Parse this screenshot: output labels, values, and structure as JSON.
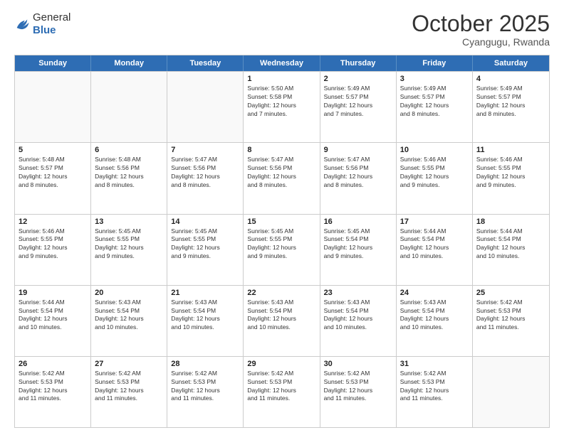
{
  "header": {
    "logo_general": "General",
    "logo_blue": "Blue",
    "month_title": "October 2025",
    "location": "Cyangugu, Rwanda"
  },
  "days_of_week": [
    "Sunday",
    "Monday",
    "Tuesday",
    "Wednesday",
    "Thursday",
    "Friday",
    "Saturday"
  ],
  "weeks": [
    [
      {
        "day": "",
        "info": "",
        "empty": true
      },
      {
        "day": "",
        "info": "",
        "empty": true
      },
      {
        "day": "",
        "info": "",
        "empty": true
      },
      {
        "day": "1",
        "info": "Sunrise: 5:50 AM\nSunset: 5:58 PM\nDaylight: 12 hours\nand 7 minutes.",
        "empty": false
      },
      {
        "day": "2",
        "info": "Sunrise: 5:49 AM\nSunset: 5:57 PM\nDaylight: 12 hours\nand 7 minutes.",
        "empty": false
      },
      {
        "day": "3",
        "info": "Sunrise: 5:49 AM\nSunset: 5:57 PM\nDaylight: 12 hours\nand 8 minutes.",
        "empty": false
      },
      {
        "day": "4",
        "info": "Sunrise: 5:49 AM\nSunset: 5:57 PM\nDaylight: 12 hours\nand 8 minutes.",
        "empty": false
      }
    ],
    [
      {
        "day": "5",
        "info": "Sunrise: 5:48 AM\nSunset: 5:57 PM\nDaylight: 12 hours\nand 8 minutes.",
        "empty": false
      },
      {
        "day": "6",
        "info": "Sunrise: 5:48 AM\nSunset: 5:56 PM\nDaylight: 12 hours\nand 8 minutes.",
        "empty": false
      },
      {
        "day": "7",
        "info": "Sunrise: 5:47 AM\nSunset: 5:56 PM\nDaylight: 12 hours\nand 8 minutes.",
        "empty": false
      },
      {
        "day": "8",
        "info": "Sunrise: 5:47 AM\nSunset: 5:56 PM\nDaylight: 12 hours\nand 8 minutes.",
        "empty": false
      },
      {
        "day": "9",
        "info": "Sunrise: 5:47 AM\nSunset: 5:56 PM\nDaylight: 12 hours\nand 8 minutes.",
        "empty": false
      },
      {
        "day": "10",
        "info": "Sunrise: 5:46 AM\nSunset: 5:55 PM\nDaylight: 12 hours\nand 9 minutes.",
        "empty": false
      },
      {
        "day": "11",
        "info": "Sunrise: 5:46 AM\nSunset: 5:55 PM\nDaylight: 12 hours\nand 9 minutes.",
        "empty": false
      }
    ],
    [
      {
        "day": "12",
        "info": "Sunrise: 5:46 AM\nSunset: 5:55 PM\nDaylight: 12 hours\nand 9 minutes.",
        "empty": false
      },
      {
        "day": "13",
        "info": "Sunrise: 5:45 AM\nSunset: 5:55 PM\nDaylight: 12 hours\nand 9 minutes.",
        "empty": false
      },
      {
        "day": "14",
        "info": "Sunrise: 5:45 AM\nSunset: 5:55 PM\nDaylight: 12 hours\nand 9 minutes.",
        "empty": false
      },
      {
        "day": "15",
        "info": "Sunrise: 5:45 AM\nSunset: 5:55 PM\nDaylight: 12 hours\nand 9 minutes.",
        "empty": false
      },
      {
        "day": "16",
        "info": "Sunrise: 5:45 AM\nSunset: 5:54 PM\nDaylight: 12 hours\nand 9 minutes.",
        "empty": false
      },
      {
        "day": "17",
        "info": "Sunrise: 5:44 AM\nSunset: 5:54 PM\nDaylight: 12 hours\nand 10 minutes.",
        "empty": false
      },
      {
        "day": "18",
        "info": "Sunrise: 5:44 AM\nSunset: 5:54 PM\nDaylight: 12 hours\nand 10 minutes.",
        "empty": false
      }
    ],
    [
      {
        "day": "19",
        "info": "Sunrise: 5:44 AM\nSunset: 5:54 PM\nDaylight: 12 hours\nand 10 minutes.",
        "empty": false
      },
      {
        "day": "20",
        "info": "Sunrise: 5:43 AM\nSunset: 5:54 PM\nDaylight: 12 hours\nand 10 minutes.",
        "empty": false
      },
      {
        "day": "21",
        "info": "Sunrise: 5:43 AM\nSunset: 5:54 PM\nDaylight: 12 hours\nand 10 minutes.",
        "empty": false
      },
      {
        "day": "22",
        "info": "Sunrise: 5:43 AM\nSunset: 5:54 PM\nDaylight: 12 hours\nand 10 minutes.",
        "empty": false
      },
      {
        "day": "23",
        "info": "Sunrise: 5:43 AM\nSunset: 5:54 PM\nDaylight: 12 hours\nand 10 minutes.",
        "empty": false
      },
      {
        "day": "24",
        "info": "Sunrise: 5:43 AM\nSunset: 5:54 PM\nDaylight: 12 hours\nand 10 minutes.",
        "empty": false
      },
      {
        "day": "25",
        "info": "Sunrise: 5:42 AM\nSunset: 5:53 PM\nDaylight: 12 hours\nand 11 minutes.",
        "empty": false
      }
    ],
    [
      {
        "day": "26",
        "info": "Sunrise: 5:42 AM\nSunset: 5:53 PM\nDaylight: 12 hours\nand 11 minutes.",
        "empty": false
      },
      {
        "day": "27",
        "info": "Sunrise: 5:42 AM\nSunset: 5:53 PM\nDaylight: 12 hours\nand 11 minutes.",
        "empty": false
      },
      {
        "day": "28",
        "info": "Sunrise: 5:42 AM\nSunset: 5:53 PM\nDaylight: 12 hours\nand 11 minutes.",
        "empty": false
      },
      {
        "day": "29",
        "info": "Sunrise: 5:42 AM\nSunset: 5:53 PM\nDaylight: 12 hours\nand 11 minutes.",
        "empty": false
      },
      {
        "day": "30",
        "info": "Sunrise: 5:42 AM\nSunset: 5:53 PM\nDaylight: 12 hours\nand 11 minutes.",
        "empty": false
      },
      {
        "day": "31",
        "info": "Sunrise: 5:42 AM\nSunset: 5:53 PM\nDaylight: 12 hours\nand 11 minutes.",
        "empty": false
      },
      {
        "day": "",
        "info": "",
        "empty": true
      }
    ]
  ]
}
